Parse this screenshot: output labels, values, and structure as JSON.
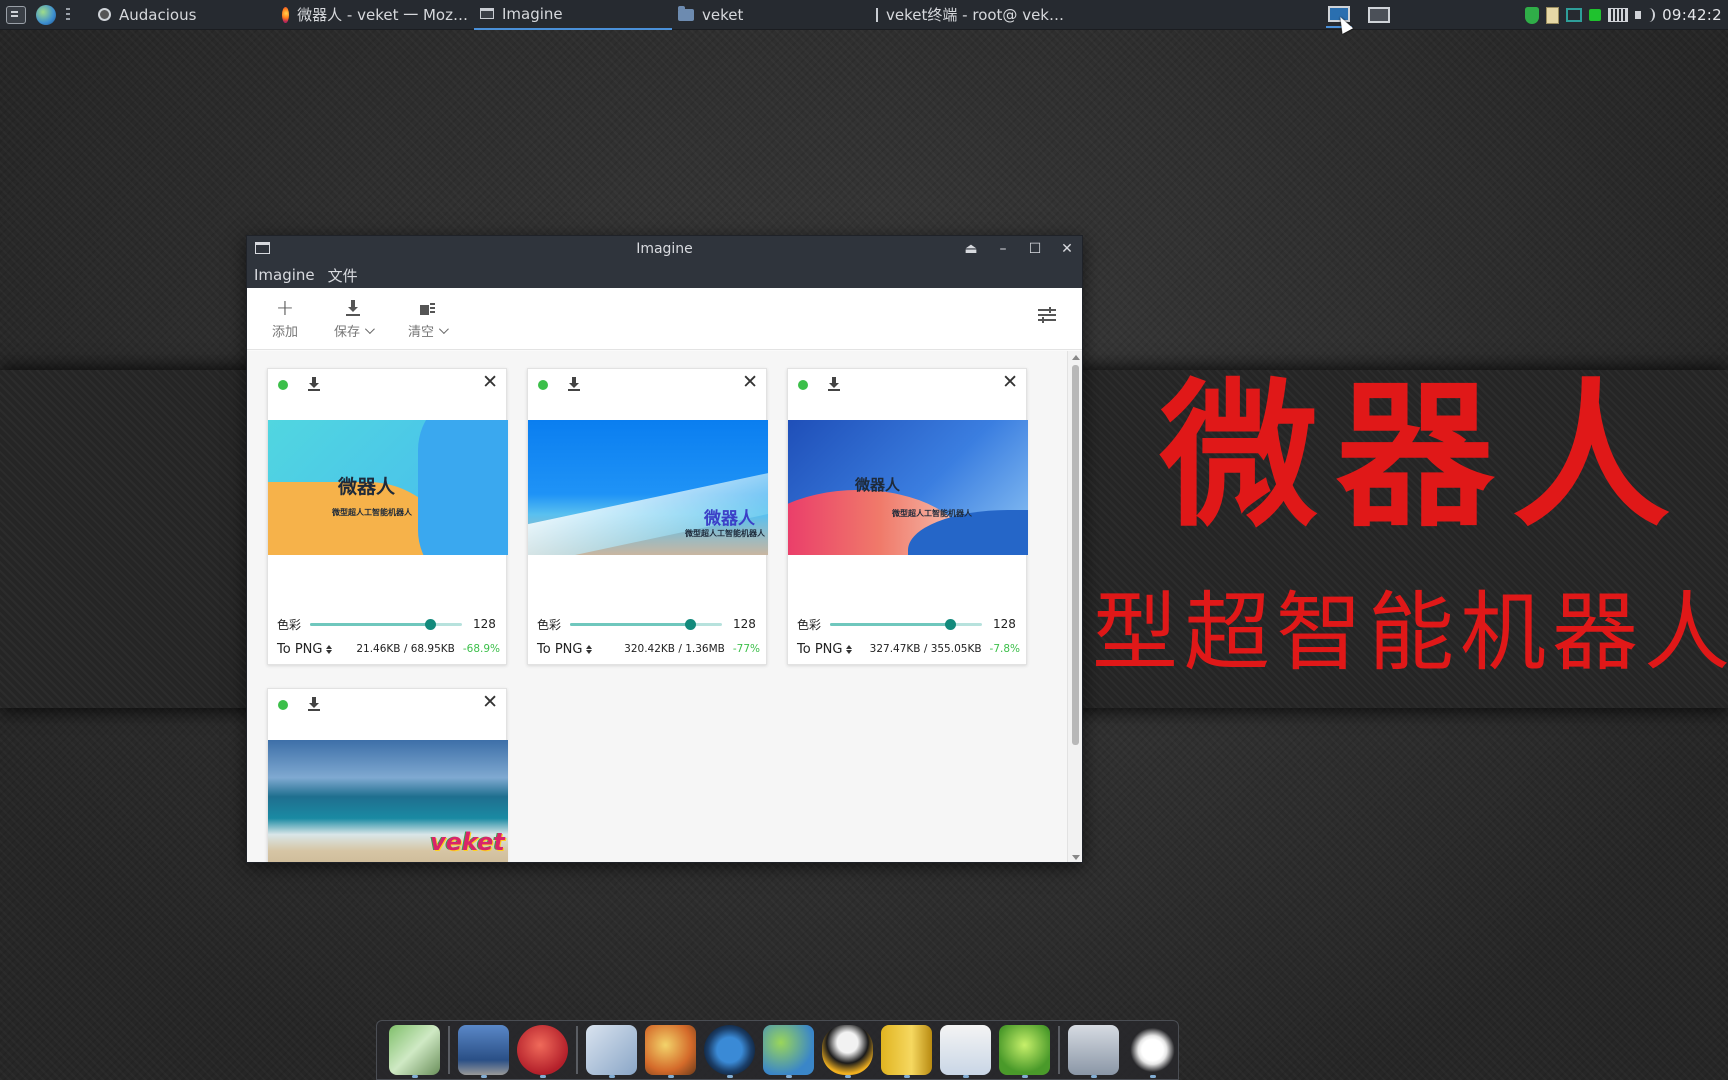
{
  "taskbar": {
    "tasks": [
      {
        "label": "Audacious",
        "active": false
      },
      {
        "label": "微器人 - veket 一 Moz…",
        "active": false
      },
      {
        "label": "Imagine",
        "active": true
      },
      {
        "label": "veket",
        "active": false
      },
      {
        "label": "veket终端 - root@ vek…",
        "active": false
      }
    ],
    "clock": "09:42:2"
  },
  "wallpaper": {
    "title": "微器人",
    "subtitle": "微型超智能机器人"
  },
  "window": {
    "title": "Imagine",
    "menu": [
      "Imagine",
      "文件"
    ],
    "toolbar": {
      "add_label": "添加",
      "save_label": "保存",
      "clear_label": "清空"
    }
  },
  "cards": [
    {
      "thumb_title": "微器人",
      "thumb_sub": "微型超人工智能机器人",
      "slider_label": "色彩",
      "slider_value": 128,
      "slider_max": 256,
      "format": "To PNG",
      "size": "21.46KB / 68.95KB",
      "percent": "-68.9%"
    },
    {
      "thumb_title": "微器人",
      "thumb_sub": "微型超人工智能机器人",
      "slider_label": "色彩",
      "slider_value": 128,
      "slider_max": 256,
      "format": "To PNG",
      "size": "320.42KB / 1.36MB",
      "percent": "-77%"
    },
    {
      "thumb_title": "微器人",
      "thumb_sub": "微型超人工智能机器人",
      "slider_label": "色彩",
      "slider_value": 128,
      "slider_max": 256,
      "format": "To PNG",
      "size": "327.47KB / 355.05KB",
      "percent": "-7.8%"
    },
    {
      "thumb_title": "veket"
    }
  ],
  "colors": {
    "accent_green": "#3cbf4a",
    "slider_knob": "#128a7c",
    "wallpaper_text": "#e01818",
    "panel_bg": "#262a30"
  },
  "icons": {
    "add": "plus-icon",
    "save": "download-icon",
    "clear": "clear-all-icon",
    "settings": "tune-icon",
    "close": "close-icon"
  }
}
